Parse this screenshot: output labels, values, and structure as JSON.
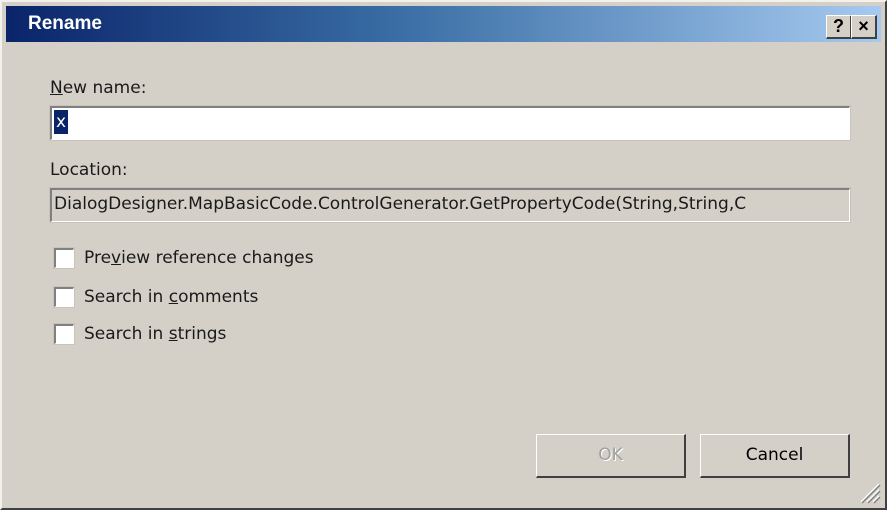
{
  "window": {
    "title": "Rename",
    "help_button": "?",
    "close_button": "×"
  },
  "new_name": {
    "label_prefix": "",
    "label_accel": "N",
    "label_rest": "ew name:",
    "value": "x"
  },
  "location": {
    "label": "Location:",
    "value": "DialogDesigner.MapBasicCode.ControlGenerator.GetPropertyCode(String,String,C"
  },
  "options": [
    {
      "prefix": "Pre",
      "accel": "v",
      "rest": "iew reference changes",
      "checked": false
    },
    {
      "prefix": "Search in ",
      "accel": "c",
      "rest": "omments",
      "checked": false
    },
    {
      "prefix": "Search in ",
      "accel": "s",
      "rest": "trings",
      "checked": false
    }
  ],
  "buttons": {
    "ok_label": "OK",
    "cancel_label": "Cancel"
  },
  "colors": {
    "title_gradient_start": "#0a246a",
    "title_gradient_end": "#a6caf0",
    "dialog_face": "#d4d0c8",
    "selection": "#0a246a"
  }
}
